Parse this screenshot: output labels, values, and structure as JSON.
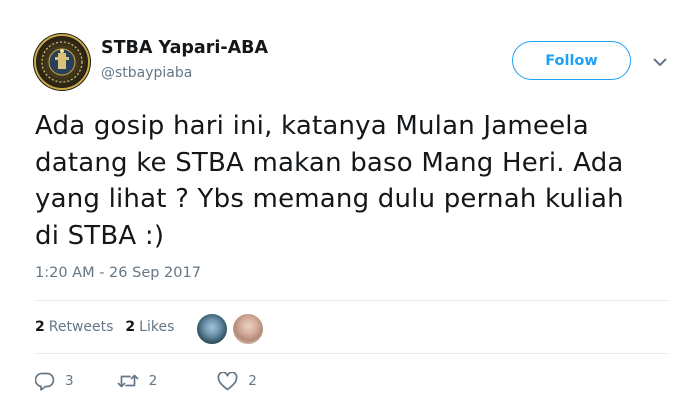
{
  "user": {
    "display_name": "STBA Yapari-ABA",
    "handle": "@stbaypiaba"
  },
  "header": {
    "follow_label": "Follow"
  },
  "tweet": {
    "lines": [
      "Ada gosip hari ini, katanya Mulan Jameela",
      "datang ke STBA makan baso Mang Heri. Ada",
      "yang lihat ? Ybs memang dulu pernah kuliah",
      "di STBA :)"
    ],
    "timestamp": "1:20 AM - 26 Sep 2017"
  },
  "stats": {
    "retweets_count": "2",
    "retweets_label": "Retweets",
    "likes_count": "2",
    "likes_label": "Likes"
  },
  "actions": {
    "reply_count": "3",
    "retweet_count": "2",
    "like_count": "2"
  },
  "colors": {
    "accent": "#1da1f2",
    "secondary_text": "#657786",
    "divider": "#e6ecf0"
  },
  "icons": [
    "chevron-down-icon",
    "reply-icon",
    "retweet-icon",
    "heart-icon"
  ]
}
